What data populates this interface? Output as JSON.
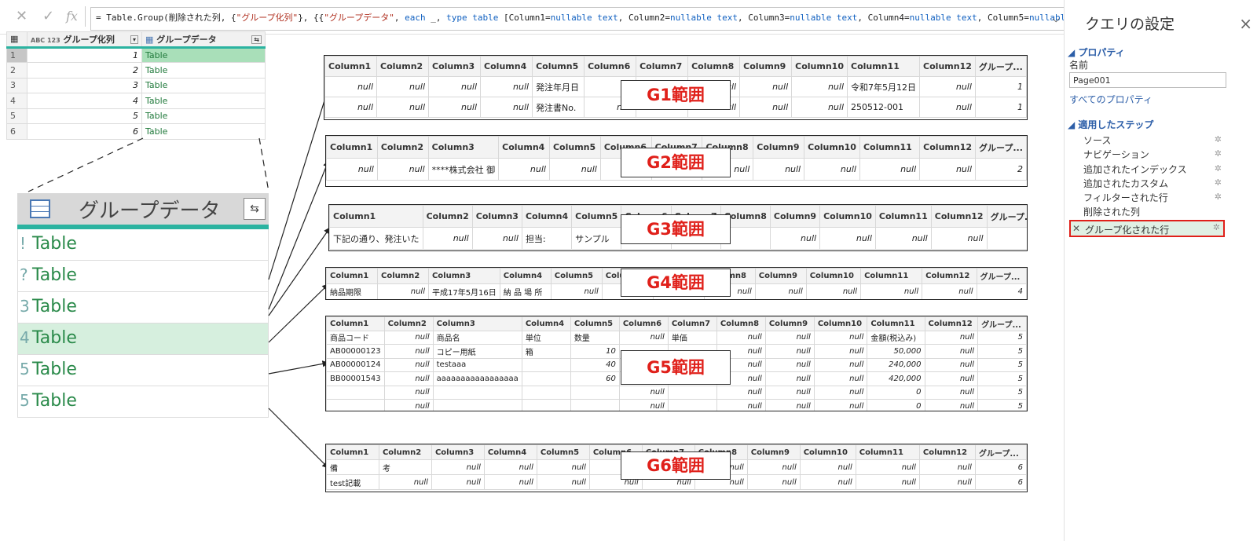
{
  "formula_bar": {
    "cancel": "✕",
    "confirm": "✓",
    "fx": "fx",
    "formula_a": "= Table.Group(削除された列, {",
    "formula_b": "\"グループ化列\"",
    "formula_c": "}, {{",
    "formula_d": "\"グループデータ\"",
    "formula_e": ", ",
    "formula_f": "each",
    "formula_g": " _, ",
    "formula_h": "type table",
    "formula_i": " [Column1=",
    "formula_j": "nullable text",
    "formula_k": ", Column2=",
    "formula_l": ", Column3=",
    "formula_m": ", Column4=",
    "formula_n": ", Column5=",
    "formula_o": "nullable"
  },
  "grid": {
    "col1_header": "グループ化列",
    "col1_type": "ABC 123",
    "col2_header": "グループデータ",
    "rows": [
      {
        "n": "1",
        "group": "1",
        "data": "Table"
      },
      {
        "n": "2",
        "group": "2",
        "data": "Table"
      },
      {
        "n": "3",
        "group": "3",
        "data": "Table"
      },
      {
        "n": "4",
        "group": "4",
        "data": "Table"
      },
      {
        "n": "5",
        "group": "5",
        "data": "Table"
      },
      {
        "n": "6",
        "group": "6",
        "data": "Table"
      }
    ]
  },
  "zoom": {
    "header": "グループデータ",
    "rows": [
      "Table",
      "Table",
      "Table",
      "Table",
      "Table",
      "Table"
    ],
    "row_index_fragments": [
      "!",
      "?",
      "3",
      "4",
      "5",
      "5"
    ]
  },
  "ranges": {
    "g1": {
      "label": "G1範囲",
      "headers": [
        "Column1",
        "Column2",
        "Column3",
        "Column4",
        "Column5",
        "Column6",
        "Column7",
        "Column8",
        "Column9",
        "Column10",
        "Column11",
        "Column12",
        "グループ..."
      ],
      "rows": [
        [
          "null",
          "null",
          "null",
          "null",
          "発注年月日",
          "",
          "",
          "null",
          "null",
          "null",
          "令和7年5月12日",
          "null",
          "1"
        ],
        [
          "null",
          "null",
          "null",
          "null",
          "発注書No.",
          "null",
          "null",
          "null",
          "null",
          "null",
          "250512-001",
          "null",
          "1"
        ]
      ]
    },
    "g2": {
      "label": "G2範囲",
      "headers": [
        "Column1",
        "Column2",
        "Column3",
        "Column4",
        "Column5",
        "Column6",
        "Column7",
        "Column8",
        "Column9",
        "Column10",
        "Column11",
        "Column12",
        "グループ..."
      ],
      "rows": [
        [
          "null",
          "null",
          "****株式会社 御",
          "null",
          "null",
          "null",
          "null",
          "null",
          "null",
          "null",
          "null",
          "null",
          "2"
        ]
      ]
    },
    "g3": {
      "label": "G3範囲",
      "headers": [
        "Column1",
        "Column2",
        "Column3",
        "Column4",
        "Column5",
        "Column6",
        "Column7",
        "Column8",
        "Column9",
        "Column10",
        "Column11",
        "Column12",
        "グループ..."
      ],
      "rows": [
        [
          "下記の通り、発注いた",
          "null",
          "null",
          "担当:",
          "サンプル",
          "",
          "",
          "",
          "null",
          "null",
          "null",
          "null",
          "3"
        ]
      ]
    },
    "g4": {
      "label": "G4範囲",
      "headers": [
        "Column1",
        "Column2",
        "Column3",
        "Column4",
        "Column5",
        "Column6",
        "Column7",
        "Column8",
        "Column9",
        "Column10",
        "Column11",
        "Column12",
        "グループ..."
      ],
      "rows": [
        [
          "納品期限",
          "null",
          "平成17年5月16日",
          "納 品 場 所",
          "null",
          "",
          "",
          "null",
          "null",
          "null",
          "null",
          "null",
          "4"
        ]
      ]
    },
    "g5": {
      "label": "G5範囲",
      "headers": [
        "Column1",
        "Column2",
        "Column3",
        "Column4",
        "Column5",
        "Column6",
        "Column7",
        "Column8",
        "Column9",
        "Column10",
        "Column11",
        "Column12",
        "グループ..."
      ],
      "rows": [
        [
          "商品コード",
          "null",
          "商品名",
          "単位",
          "数量",
          "null",
          "単価",
          "null",
          "null",
          "null",
          "金額(税込み)",
          "null",
          "5"
        ],
        [
          "AB00000123",
          "null",
          "コピー用紙",
          "箱",
          "10",
          "",
          "",
          "null",
          "null",
          "null",
          "50,000",
          "null",
          "5"
        ],
        [
          "AB00000124",
          "null",
          "testaaa",
          "",
          "40",
          "",
          "",
          "null",
          "null",
          "null",
          "240,000",
          "null",
          "5"
        ],
        [
          "BB00001543",
          "null",
          "aaaaaaaaaaaaaaaaa",
          "",
          "60",
          "null",
          "7,000",
          "null",
          "null",
          "null",
          "420,000",
          "null",
          "5"
        ],
        [
          "",
          "null",
          "",
          "",
          "",
          "null",
          "",
          "null",
          "null",
          "null",
          "0",
          "null",
          "5"
        ],
        [
          "",
          "null",
          "",
          "",
          "",
          "null",
          "",
          "null",
          "null",
          "null",
          "0",
          "null",
          "5"
        ]
      ]
    },
    "g6": {
      "label": "G6範囲",
      "headers": [
        "Column1",
        "Column2",
        "Column3",
        "Column4",
        "Column5",
        "Column6",
        "Column7",
        "Column8",
        "Column9",
        "Column10",
        "Column11",
        "Column12",
        "グループ..."
      ],
      "rows": [
        [
          "備",
          "考",
          "null",
          "null",
          "null",
          "null",
          "null",
          "null",
          "null",
          "null",
          "null",
          "null",
          "6"
        ],
        [
          "test記載",
          "null",
          "null",
          "null",
          "null",
          "null",
          "null",
          "null",
          "null",
          "null",
          "null",
          "null",
          "6"
        ]
      ]
    }
  },
  "panel": {
    "title": "クエリの設定",
    "close": "×",
    "properties_header": "プロパティ",
    "name_label": "名前",
    "name_value": "Page001",
    "all_properties": "すべてのプロパティ",
    "steps_header": "適用したステップ",
    "steps": [
      "ソース",
      "ナビゲーション",
      "追加されたインデックス",
      "追加されたカスタム",
      "フィルターされた行",
      "削除された列",
      "グループ化された行"
    ]
  },
  "colors": {
    "accent_teal": "#2bb3a0",
    "table_green": "#217a3c",
    "selection_green": "#a9dfb9",
    "annotation_red": "#e0201a",
    "link_blue": "#2c5ea8"
  }
}
